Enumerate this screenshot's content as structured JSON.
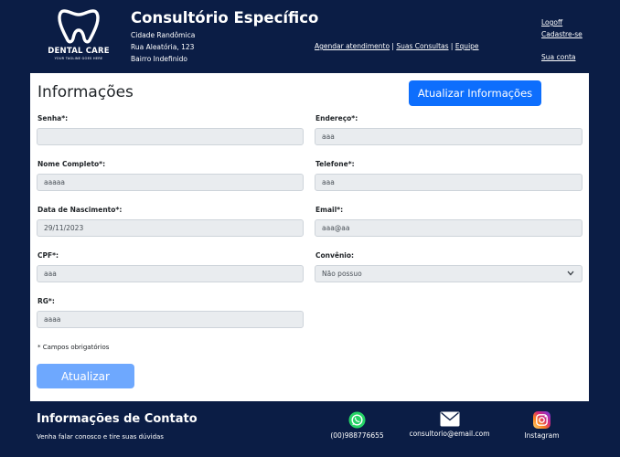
{
  "header": {
    "logo_text": "DENTAL CARE",
    "logo_tagline": "YOUR TAGLINE GOES HERE",
    "clinic_name": "Consultório Específico",
    "address": [
      "Cidade Randômica",
      "Rua Aleatória, 123",
      "Bairro Indefinido"
    ],
    "nav": {
      "schedule": "Agendar atendimento",
      "consultations": "Suas Consultas",
      "team": "Equipe",
      "separator": " | "
    },
    "account": {
      "logoff": "Logoff",
      "signup": "Cadastre-se",
      "my_account": "Sua conta"
    }
  },
  "main": {
    "title": "Informações",
    "update_info_button": "Atualizar Informações",
    "fields": {
      "password": {
        "label": "Senha*:",
        "value": ""
      },
      "address": {
        "label": "Endereço*:",
        "value": "aaa"
      },
      "full_name": {
        "label": "Nome Completo*:",
        "value": "aaaaa"
      },
      "phone": {
        "label": "Telefone*:",
        "value": "aaa"
      },
      "birth_date": {
        "label": "Data de Nascimento*:",
        "value": "29/11/2023"
      },
      "email": {
        "label": "Email*:",
        "value": "aaa@aa"
      },
      "cpf": {
        "label": "CPF*:",
        "value": "aaa"
      },
      "insurance": {
        "label": "Convênio:",
        "value": "Não possuo"
      },
      "rg": {
        "label": "RG*:",
        "value": "aaaa"
      }
    },
    "required_note": "* Campos obrigatórios",
    "submit_button": "Atualizar"
  },
  "footer": {
    "title": "Informações de Contato",
    "subtitle": "Venha falar conosco e tire suas dúvidas",
    "phone": "(00)988776655",
    "email": "consultorio@email.com",
    "instagram": "Instagram"
  },
  "colors": {
    "background": "#0b1d45",
    "primary": "#0d6efd",
    "primary_disabled": "#6ea8fe",
    "whatsapp": "#25d366"
  },
  "icons": [
    "tooth-logo-icon",
    "chevron-down-icon",
    "whatsapp-icon",
    "envelope-icon",
    "instagram-icon"
  ]
}
